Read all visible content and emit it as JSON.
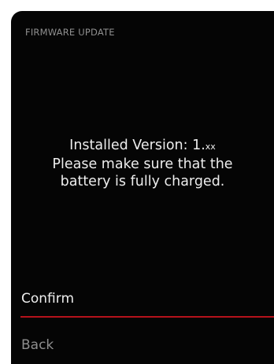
{
  "screen": {
    "title": "FIRMWARE UPDATE",
    "message": {
      "version_prefix": "Installed Version: 1.",
      "version_suffix": "xx",
      "line2": "Please make sure that the",
      "line3": "battery is fully charged."
    },
    "menu": {
      "confirm_label": "Confirm",
      "back_label": "Back"
    }
  },
  "colors": {
    "background": "#050505",
    "text_primary": "#ededed",
    "text_secondary": "#8e8e8e",
    "accent_divider": "#b5121b"
  }
}
